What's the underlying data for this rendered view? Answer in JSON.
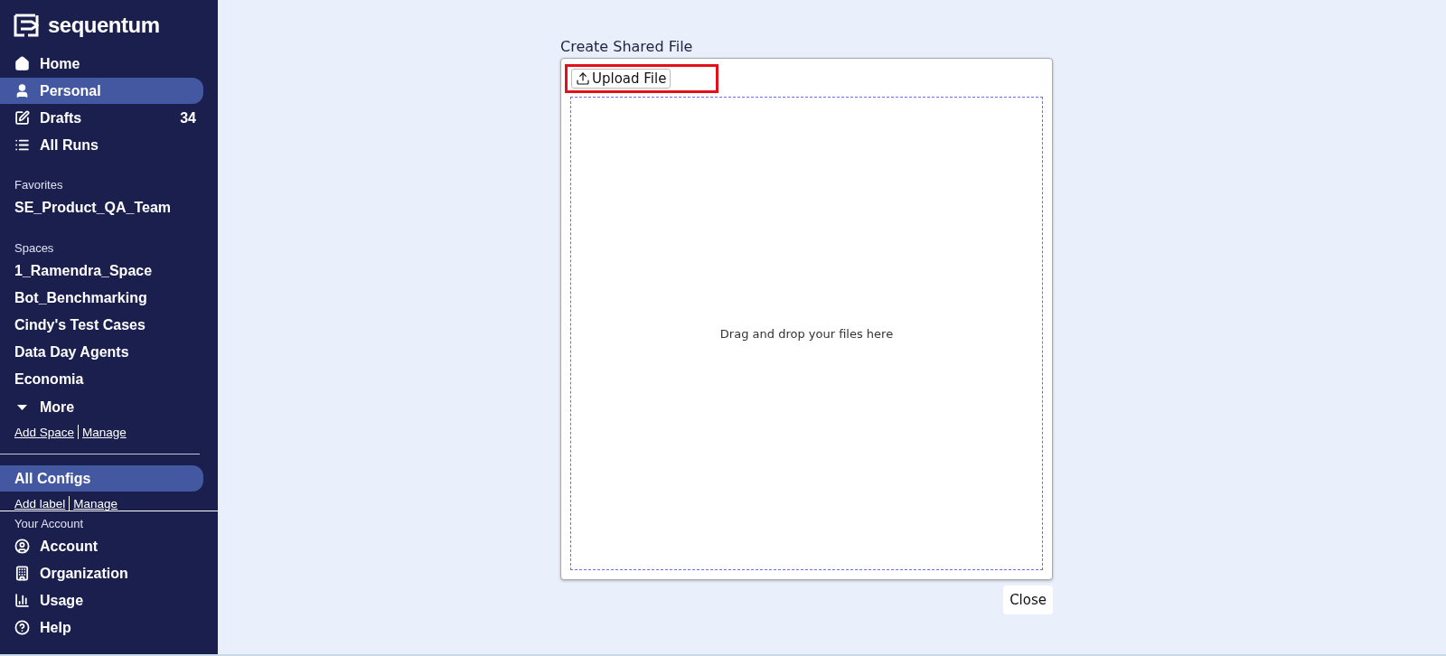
{
  "sidebar": {
    "brand": "sequentum",
    "nav": [
      {
        "kind": "home",
        "label": "Home",
        "selected": false
      },
      {
        "kind": "personal",
        "label": "Personal",
        "selected": true
      },
      {
        "kind": "drafts",
        "label": "Drafts",
        "count": "34",
        "selected": false
      },
      {
        "kind": "runs",
        "label": "All Runs",
        "selected": false
      }
    ],
    "favorites": {
      "heading": "Favorites",
      "items": [
        "SE_Product_QA_Team"
      ]
    },
    "spaces": {
      "heading": "Spaces",
      "items": [
        "1_Ramendra_Space",
        "Bot_Benchmarking",
        "Cindy's Test Cases",
        "Data Day Agents",
        "Economia"
      ],
      "more": "More",
      "links": [
        "Add Space",
        "Manage"
      ]
    },
    "labels": {
      "items": [
        {
          "label": "All Configs",
          "selected": true
        }
      ],
      "links": [
        "Add label",
        "Manage"
      ]
    },
    "account": {
      "heading": "Your Account",
      "items": [
        {
          "kind": "account",
          "label": "Account"
        },
        {
          "kind": "organization",
          "label": "Organization"
        },
        {
          "kind": "usage",
          "label": "Usage"
        },
        {
          "kind": "help",
          "label": "Help"
        }
      ]
    }
  },
  "dialog": {
    "title": "Create Shared File",
    "upload_button": {
      "label": "Upload File",
      "highlighted": true
    },
    "dropzone": {
      "text": "Drag and drop your files here"
    },
    "close_button": "Close"
  }
}
